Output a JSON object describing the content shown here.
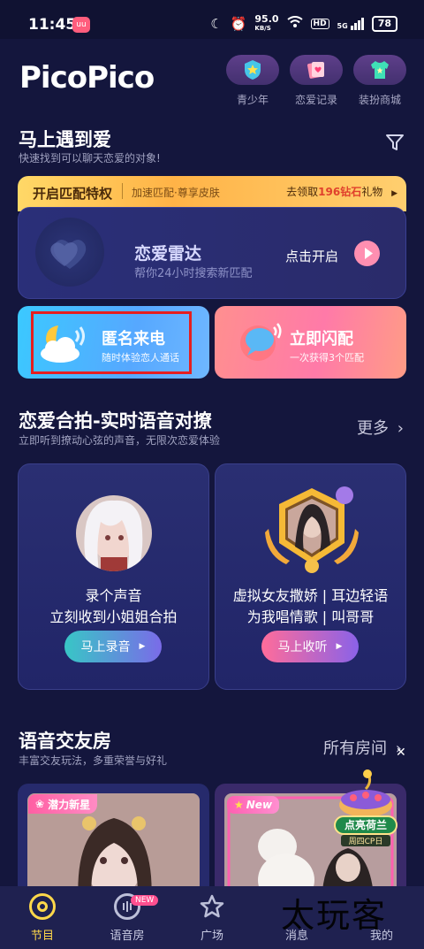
{
  "status": {
    "time": "11:45",
    "app_badge": "uu",
    "speed": "95.0",
    "speed_unit": "KB/S",
    "hd": "HD",
    "signal": "5G",
    "battery": "78"
  },
  "header": {
    "logo": "PicoPico",
    "buttons": [
      {
        "label": "青少年",
        "icon": "shield-star-icon"
      },
      {
        "label": "恋爱记录",
        "icon": "love-card-icon"
      },
      {
        "label": "装扮商城",
        "icon": "shirt-icon"
      }
    ]
  },
  "match": {
    "title": "马上遇到爱",
    "subtitle": "快速找到可以聊天恋爱的对象!",
    "privilege": {
      "title": "开启匹配特权",
      "sub": "加速匹配·尊享皮肤",
      "right_prefix": "去领取",
      "right_highlight": "196钻石",
      "right_suffix": "礼物"
    },
    "radar": {
      "title": "恋爱雷达",
      "subtitle": "帮你24小时搜索新匹配",
      "button": "点击开启"
    },
    "anon_call": {
      "title": "匿名来电",
      "subtitle": "随时体验恋人通话"
    },
    "flash_match": {
      "title": "立即闪配",
      "subtitle": "一次获得3个匹配"
    }
  },
  "duet": {
    "title": "恋爱合拍-实时语音对撩",
    "subtitle": "立即听到撩动心弦的声音，无限次恋爱体验",
    "more": "更多",
    "cards": [
      {
        "line1": "录个声音",
        "line2": "立刻收到小姐姐合拍",
        "button": "马上录音"
      },
      {
        "line1": "虚拟女友撒娇 | 耳边轻语",
        "line2": "为我唱情歌 | 叫哥哥",
        "button": "马上收听"
      }
    ]
  },
  "rooms": {
    "title": "语音交友房",
    "subtitle": "丰富交友玩法，多重荣誉与好礼",
    "more": "所有房间",
    "tags": [
      "潜力新星",
      "New"
    ],
    "promo": {
      "label": "点亮荷兰",
      "sub": "周四CP日"
    }
  },
  "nav": {
    "items": [
      {
        "label": "节目",
        "icon": "program-icon"
      },
      {
        "label": "语音房",
        "icon": "voice-room-icon"
      },
      {
        "label": "广场",
        "icon": "plaza-icon"
      },
      {
        "label": "消息",
        "icon": "message-icon"
      },
      {
        "label": "我的",
        "icon": "profile-icon"
      }
    ],
    "new_badge": "NEW"
  },
  "watermark": "太玩客",
  "colors": {
    "background": "#14163d",
    "accent_pink": "#ff4f8f",
    "gold": "#ffb347"
  }
}
